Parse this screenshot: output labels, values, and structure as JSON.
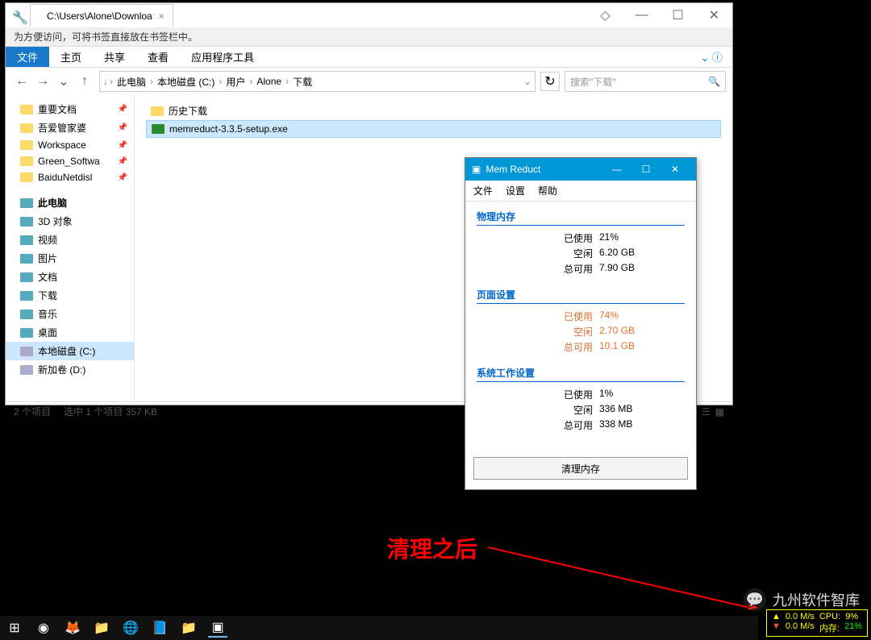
{
  "explorer": {
    "tab_title": "C:\\Users\\Alone\\Downloa",
    "banner": "为方便访问，可将书签直接放在书签栏中。",
    "menu": {
      "file": "文件",
      "home": "主页",
      "share": "共享",
      "view": "查看",
      "apptools": "应用程序工具"
    },
    "breadcrumb": [
      "此电脑",
      "本地磁盘 (C:)",
      "用户",
      "Alone",
      "下载"
    ],
    "search_placeholder": "搜索\"下载\"",
    "sidebar": {
      "quick": [
        {
          "label": "重要文档"
        },
        {
          "label": "吾爱管家婆"
        },
        {
          "label": "Workspace"
        },
        {
          "label": "Green_Softwa"
        },
        {
          "label": "BaiduNetdisl"
        }
      ],
      "thispc_label": "此电脑",
      "thispc": [
        {
          "label": "3D 对象"
        },
        {
          "label": "视频"
        },
        {
          "label": "图片"
        },
        {
          "label": "文档"
        },
        {
          "label": "下载"
        },
        {
          "label": "音乐"
        },
        {
          "label": "桌面"
        },
        {
          "label": "本地磁盘 (C:)"
        },
        {
          "label": "新加卷 (D:)"
        }
      ]
    },
    "files": [
      {
        "name": "历史下载",
        "type": "folder"
      },
      {
        "name": "memreduct-3.3.5-setup.exe",
        "type": "exe"
      }
    ],
    "status": {
      "count": "2 个项目",
      "selected": "选中 1 个项目 357 KB"
    }
  },
  "memreduct": {
    "title": "Mem Reduct",
    "menu": {
      "file": "文件",
      "settings": "设置",
      "help": "帮助"
    },
    "groups": {
      "physical": {
        "title": "物理内存",
        "rows": [
          {
            "k": "已使用",
            "v": "21%"
          },
          {
            "k": "空闲",
            "v": "6.20 GB"
          },
          {
            "k": "总可用",
            "v": "7.90 GB"
          }
        ]
      },
      "pagefile": {
        "title": "页面设置",
        "rows": [
          {
            "k": "已使用",
            "v": "74%"
          },
          {
            "k": "空闲",
            "v": "2.70 GB"
          },
          {
            "k": "总可用",
            "v": "10.1 GB"
          }
        ]
      },
      "syswork": {
        "title": "系统工作设置",
        "rows": [
          {
            "k": "已使用",
            "v": "1%"
          },
          {
            "k": "空闲",
            "v": "336 MB"
          },
          {
            "k": "总可用",
            "v": "338 MB"
          }
        ]
      }
    },
    "button": "清理内存"
  },
  "annotation": "清理之后",
  "watermark": "九州软件智库",
  "overlay": {
    "r1": {
      "a": "▲",
      "b": "0.0 M/s",
      "c": "CPU:",
      "d": "9%"
    },
    "r2": {
      "a": "▼",
      "b": "0.0 M/s",
      "c": "内存:",
      "d": "21%"
    }
  }
}
